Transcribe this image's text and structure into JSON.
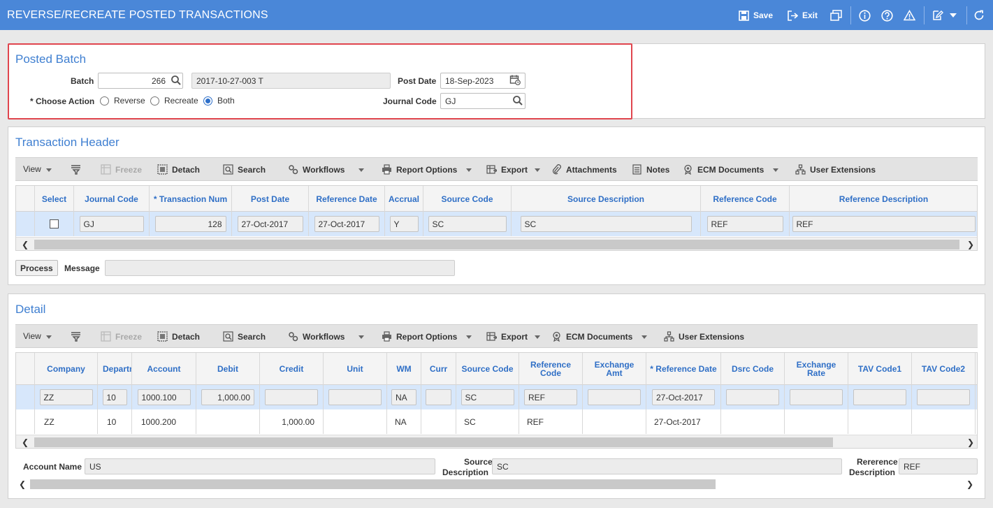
{
  "window": {
    "title": "REVERSE/RECREATE POSTED TRANSACTIONS",
    "save_label": "Save",
    "exit_label": "Exit",
    "accent": "#4a87d8"
  },
  "posted_batch": {
    "title": "Posted Batch",
    "batch_label": "Batch",
    "batch_value": "266",
    "batch_desc": "2017-10-27-003 T",
    "post_date_label": "Post Date",
    "post_date_value": "18-Sep-2023",
    "choose_action_label": "* Choose Action",
    "actions": [
      "Reverse",
      "Recreate",
      "Both"
    ],
    "selected_action": "Both",
    "journal_code_label": "Journal Code",
    "journal_code_value": "GJ"
  },
  "transaction_header": {
    "title": "Transaction Header",
    "toolbar": {
      "view": "View",
      "freeze": "Freeze",
      "detach": "Detach",
      "search": "Search",
      "workflows": "Workflows",
      "report_options": "Report Options",
      "export": "Export",
      "attachments": "Attachments",
      "notes": "Notes",
      "ecm": "ECM Documents",
      "user_ext": "User Extensions"
    },
    "columns": [
      "Select",
      "Journal Code",
      "* Transaction Num",
      "Post Date",
      "Reference Date",
      "Accrual",
      "Source Code",
      "Source Description",
      "Reference Code",
      "Reference Description"
    ],
    "row": {
      "journal_code": "GJ",
      "transaction_num": "128",
      "post_date": "27-Oct-2017",
      "reference_date": "27-Oct-2017",
      "accrual": "Y",
      "source_code": "SC",
      "source_description": "SC",
      "reference_code": "REF",
      "reference_description": "REF"
    },
    "process_label": "Process",
    "message_label": "Message",
    "message_value": ""
  },
  "detail": {
    "title": "Detail",
    "toolbar": {
      "view": "View",
      "freeze": "Freeze",
      "detach": "Detach",
      "search": "Search",
      "workflows": "Workflows",
      "report_options": "Report Options",
      "export": "Export",
      "ecm": "ECM Documents",
      "user_ext": "User Extensions"
    },
    "columns": [
      "Company",
      "Departn",
      "Account",
      "Debit",
      "Credit",
      "Unit",
      "WM",
      "Curr",
      "Source Code",
      "Reference Code",
      "Exchange Amt",
      "* Reference Date",
      "Dsrc Code",
      "Exchange Rate",
      "TAV Code1",
      "TAV Code2"
    ],
    "rows": [
      {
        "company": "ZZ",
        "dept": "10",
        "account": "1000.100",
        "debit": "1,000.00",
        "credit": "",
        "unit": "",
        "wm": "NA",
        "curr": "",
        "source_code": "SC",
        "reference_code": "REF",
        "exchange_amt": "",
        "reference_date": "27-Oct-2017",
        "dsrc_code": "",
        "exchange_rate": "",
        "tav1": "",
        "tav2": ""
      },
      {
        "company": "ZZ",
        "dept": "10",
        "account": "1000.200",
        "debit": "",
        "credit": "1,000.00",
        "unit": "",
        "wm": "NA",
        "curr": "",
        "source_code": "SC",
        "reference_code": "REF",
        "exchange_amt": "",
        "reference_date": "27-Oct-2017",
        "dsrc_code": "",
        "exchange_rate": "",
        "tav1": "",
        "tav2": ""
      }
    ],
    "account_name_label": "Account Name",
    "account_name_value": "US",
    "source_desc_label_1": "Source",
    "source_desc_label_2": "Description",
    "source_desc_value": "SC",
    "ref_desc_label_1": "Rererence",
    "ref_desc_label_2": "Description",
    "ref_desc_value": "REF"
  }
}
